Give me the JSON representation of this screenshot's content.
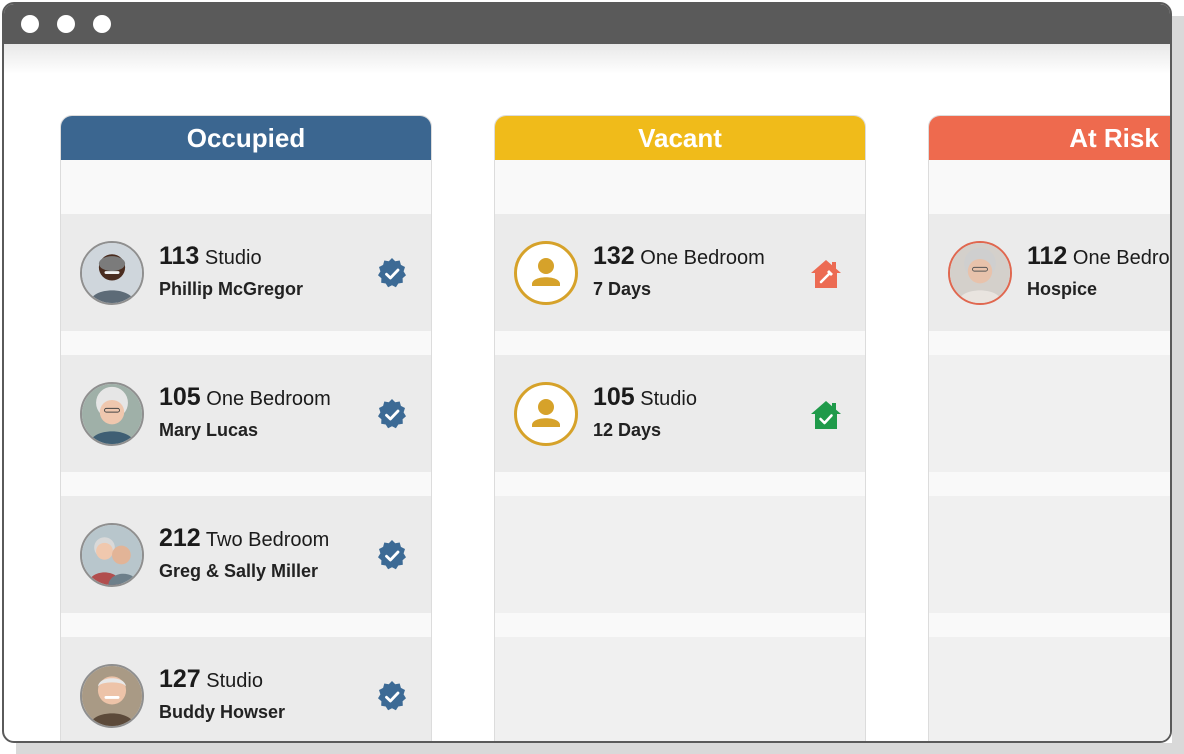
{
  "window": {
    "controls": [
      "window-dot-1",
      "window-dot-2",
      "window-dot-3"
    ]
  },
  "colors": {
    "occupied": "#3b6690",
    "vacant": "#f0bb1a",
    "at_risk": "#ee6a4e",
    "verified_badge": "#3c6a95",
    "home_alert": "#ec6b53",
    "home_ready": "#1f9a4a"
  },
  "columns": [
    {
      "title": "Occupied",
      "cards": [
        {
          "number": "113",
          "unit_type": "Studio",
          "subtitle": "Phillip McGregor",
          "icon": "verified-badge-icon"
        },
        {
          "number": "105",
          "unit_type": "One Bedroom",
          "subtitle": "Mary Lucas",
          "icon": "verified-badge-icon"
        },
        {
          "number": "212",
          "unit_type": "Two Bedroom",
          "subtitle": "Greg & Sally Miller",
          "icon": "verified-badge-icon"
        },
        {
          "number": "127",
          "unit_type": "Studio",
          "subtitle": "Buddy Howser",
          "icon": "verified-badge-icon"
        }
      ]
    },
    {
      "title": "Vacant",
      "cards": [
        {
          "number": "132",
          "unit_type": "One Bedroom",
          "subtitle": "7 Days",
          "icon": "home-repair-icon"
        },
        {
          "number": "105",
          "unit_type": "Studio",
          "subtitle": "12 Days",
          "icon": "home-check-icon"
        }
      ]
    },
    {
      "title": "At Risk",
      "cards": [
        {
          "number": "112",
          "unit_type": "One Bedroom",
          "subtitle": "Hospice",
          "icon": ""
        }
      ]
    }
  ]
}
